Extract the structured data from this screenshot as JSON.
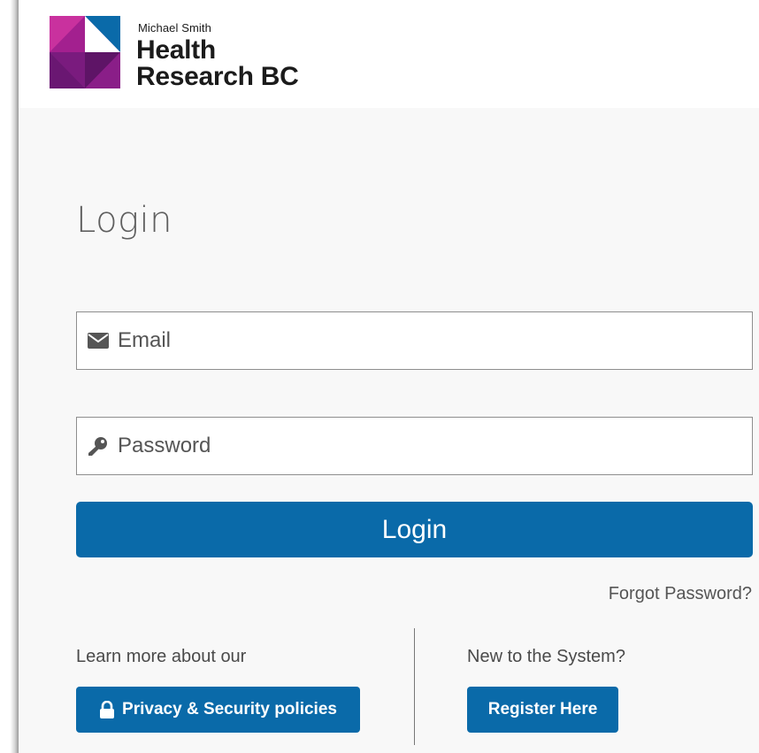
{
  "brand": {
    "small": "Michael Smith",
    "line1": "Health",
    "line2": "Research BC",
    "colors": {
      "purple": "#8e1a86",
      "blue": "#0a6aa9"
    }
  },
  "login": {
    "heading": "Login",
    "email_placeholder": "Email",
    "email_icon": "envelope-icon",
    "password_placeholder": "Password",
    "password_icon": "key-icon",
    "button_label": "Login",
    "forgot_link": "Forgot Password?"
  },
  "footer": {
    "learn_more": "Learn more about our",
    "privacy_button": "Privacy & Security policies",
    "privacy_icon": "lock-icon",
    "new_to_system": "New to the System?",
    "register_button": "Register Here"
  },
  "theme": {
    "primary": "#0a6aa9",
    "page_bg": "#f8f8f8"
  }
}
